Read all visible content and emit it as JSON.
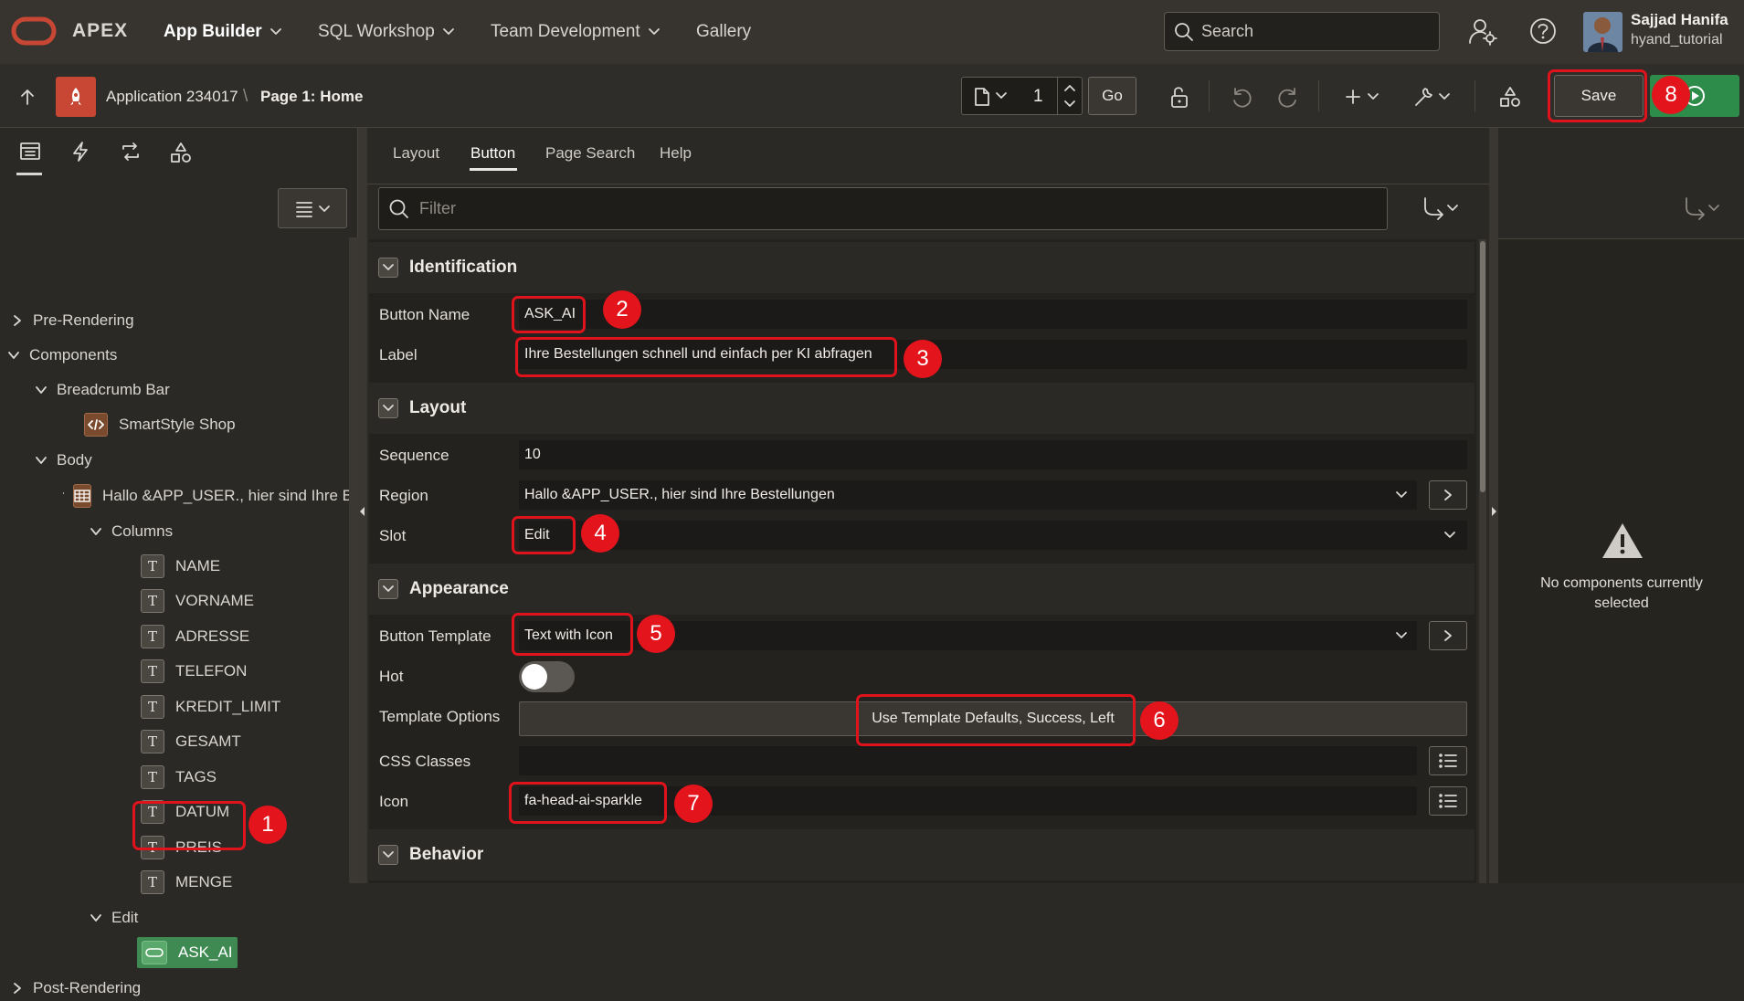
{
  "topbar": {
    "logo_text": "APEX",
    "nav": [
      "App Builder",
      "SQL Workshop",
      "Team Development",
      "Gallery"
    ],
    "search_placeholder": "Search",
    "user_name": "Sajjad Hanifa",
    "user_workspace": "hyand_tutorial"
  },
  "breadcrumb": {
    "application": "Application 234017",
    "separator": "\\",
    "page": "Page 1: Home"
  },
  "toolbar": {
    "page_number": "1",
    "go_label": "Go",
    "save_label": "Save"
  },
  "tree": {
    "pre_rendering": "Pre-Rendering",
    "components": "Components",
    "breadcrumb_bar": "Breadcrumb Bar",
    "smartstyle": "SmartStyle Shop",
    "body": "Body",
    "region": "Hallo &APP_USER., hier sind Ihre B",
    "columns_label": "Columns",
    "columns": [
      "NAME",
      "VORNAME",
      "ADRESSE",
      "TELEFON",
      "KREDIT_LIMIT",
      "GESAMT",
      "TAGS",
      "DATUM",
      "PREIS",
      "MENGE"
    ],
    "edit": "Edit",
    "ask_ai": "ASK_AI",
    "post_rendering": "Post-Rendering"
  },
  "tabs": [
    "Layout",
    "Button",
    "Page Search",
    "Help"
  ],
  "filter_placeholder": "Filter",
  "sections": {
    "identification": "Identification",
    "layout": "Layout",
    "appearance": "Appearance",
    "behavior": "Behavior"
  },
  "fields": {
    "button_name_label": "Button Name",
    "button_name_value": "ASK_AI",
    "label_label": "Label",
    "label_value": "Ihre Bestellungen schnell und einfach per KI abfragen",
    "sequence_label": "Sequence",
    "sequence_value": "10",
    "region_label": "Region",
    "region_value": "Hallo &APP_USER., hier sind Ihre Bestellungen",
    "slot_label": "Slot",
    "slot_value": "Edit",
    "button_template_label": "Button Template",
    "button_template_value": "Text with Icon",
    "hot_label": "Hot",
    "template_options_label": "Template Options",
    "template_options_value": "Use Template Defaults, Success, Left",
    "css_classes_label": "CSS Classes",
    "icon_label": "Icon",
    "icon_value": "fa-head-ai-sparkle"
  },
  "right_pane": {
    "message": "No components currently selected"
  },
  "callouts": [
    "1",
    "2",
    "3",
    "4",
    "5",
    "6",
    "7",
    "8"
  ],
  "colors": {
    "callout": "#e0121b",
    "ask_ai_bg": "#3f8a52",
    "run_green": "#2e8c4a",
    "logo_red": "#c74634"
  }
}
